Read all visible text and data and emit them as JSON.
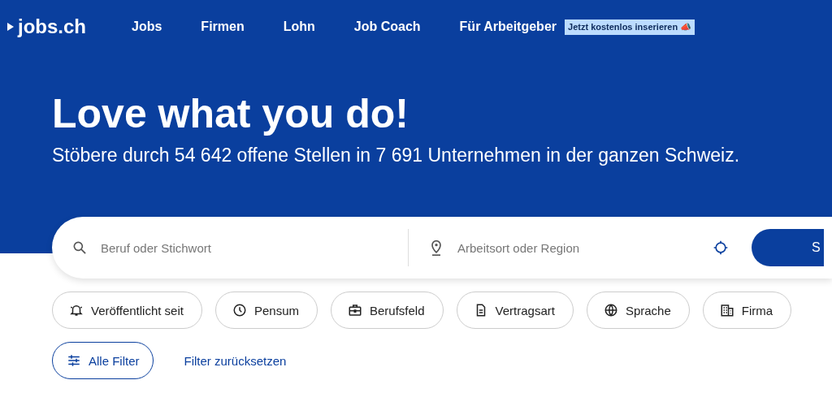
{
  "header": {
    "logo": "jobs.ch",
    "nav": [
      {
        "label": "Jobs"
      },
      {
        "label": "Firmen"
      },
      {
        "label": "Lohn"
      },
      {
        "label": "Job Coach"
      },
      {
        "label": "Für Arbeitgeber"
      }
    ],
    "promo": "Jetzt kostenlos inserieren 📣"
  },
  "hero": {
    "title": "Love what you do!",
    "subtitle": "Stöbere durch 54 642 offene Stellen in 7 691 Unternehmen in der ganzen Schweiz."
  },
  "search": {
    "keyword_placeholder": "Beruf oder Stichwort",
    "location_placeholder": "Arbeitsort oder Region",
    "button": "S"
  },
  "filters": [
    {
      "label": "Veröffentlicht seit",
      "kind": "bell"
    },
    {
      "label": "Pensum",
      "kind": "clock"
    },
    {
      "label": "Berufsfeld",
      "kind": "briefcase"
    },
    {
      "label": "Vertragsart",
      "kind": "document"
    },
    {
      "label": "Sprache",
      "kind": "globe"
    },
    {
      "label": "Firma",
      "kind": "building"
    }
  ],
  "all_filters": "Alle Filter",
  "reset": "Filter zurücksetzen"
}
